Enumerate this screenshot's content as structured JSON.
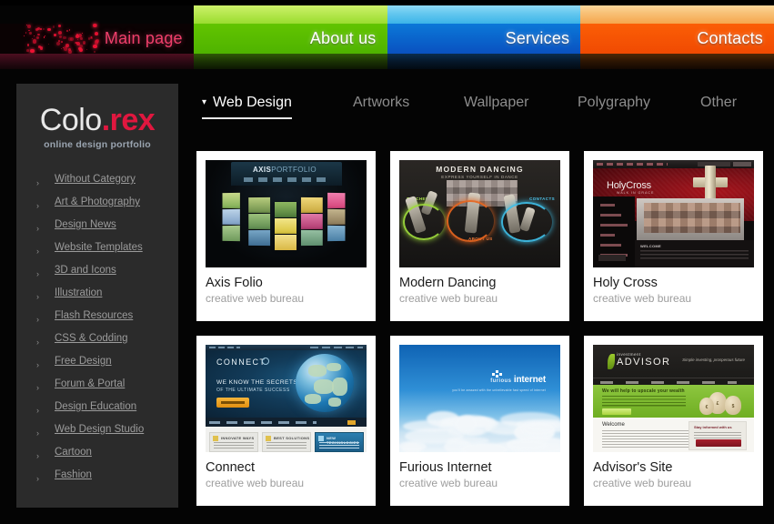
{
  "topnav": {
    "tabs": [
      {
        "label": "Main page",
        "color": "#ef3f6b",
        "theme": "pink"
      },
      {
        "label": "About us",
        "color": "#62c400",
        "theme": "green"
      },
      {
        "label": "Services",
        "color": "#0b78d8",
        "theme": "blue"
      },
      {
        "label": "Contacts",
        "color": "#fb5e06",
        "theme": "orange"
      }
    ]
  },
  "sidebar": {
    "logo": {
      "name_light": "Colo",
      "name_accent": ".rex",
      "tagline": "online design portfolio",
      "accent_color": "#e0173f"
    },
    "categories": [
      {
        "label": "Without Category"
      },
      {
        "label": "Art & Photography"
      },
      {
        "label": "Design News"
      },
      {
        "label": "Website Templates"
      },
      {
        "label": "3D and Icons"
      },
      {
        "label": "Illustration"
      },
      {
        "label": "Flash Resources"
      },
      {
        "label": "CSS & Codding"
      },
      {
        "label": "Free Design"
      },
      {
        "label": "Forum & Portal"
      },
      {
        "label": "Design Education"
      },
      {
        "label": "Web Design Studio"
      },
      {
        "label": "Cartoon"
      },
      {
        "label": "Fashion"
      }
    ],
    "bullet": "›"
  },
  "main": {
    "tabs": [
      {
        "label": "Web Design",
        "active": true,
        "icon": "chevron-down-icon"
      },
      {
        "label": "Artworks",
        "active": false
      },
      {
        "label": "Wallpaper",
        "active": false
      },
      {
        "label": "Polygraphy",
        "active": false
      },
      {
        "label": "Other",
        "active": false
      }
    ],
    "cards": [
      {
        "title": "Axis Folio",
        "subtitle": "creative web bureau",
        "thumb_text": {
          "brand_bold": "AXIS",
          "brand_light": "PORTFOLIO"
        }
      },
      {
        "title": "Modern Dancing",
        "subtitle": "creative web bureau",
        "thumb_text": {
          "title": "MODERN DANCING",
          "subtitle": "EXPRESS YOURSELF IN DANCE",
          "label_left": "TEACHERS",
          "label_right": "CONTACTS",
          "label_center": "ABOUT US"
        }
      },
      {
        "title": "Holy Cross",
        "subtitle": "creative web bureau",
        "thumb_text": {
          "brand": "HolyCross",
          "brand_sub": "WALK IN GRACE",
          "nav": [
            "HOME",
            "OUR CHURCH",
            "COMMUNITY",
            "OUR VOICES",
            "SERMONS",
            "CONTACT US"
          ],
          "button": "REGISTER HERE",
          "body_heading": "WELCOME"
        }
      },
      {
        "title": "Connect",
        "subtitle": "creative web bureau",
        "thumb_text": {
          "brand": "CONNECT",
          "headline": "WE KNOW THE SECRETS",
          "subhead": "OF THE ULTIMATE SUCCESS",
          "button": "SEE OPTIONS",
          "boxes": [
            "INNOVATE WAYS",
            "BEST SOLUTIONS",
            "NEW TECHNOLOGIES"
          ]
        }
      },
      {
        "title": "Furious Internet",
        "subtitle": "creative web bureau",
        "thumb_text": {
          "brand_light": "furious",
          "brand_bold": "internet",
          "tagline": "you'll be amazed with the unbelievable fast speed of internet"
        }
      },
      {
        "title": "Advisor's Site",
        "subtitle": "creative web bureau",
        "thumb_text": {
          "brand_small": "investment",
          "brand_big": "ADVISOR",
          "tagline": "Simple investing, prosperous future",
          "green_headline": "We will help to upscale your wealth",
          "green_button": "LEARN MORE",
          "body_heading": "Welcome",
          "box_heading": "Stay informed with us",
          "box_sub": "And how to reach goals",
          "box_button": "Subscribe now!"
        }
      }
    ]
  }
}
